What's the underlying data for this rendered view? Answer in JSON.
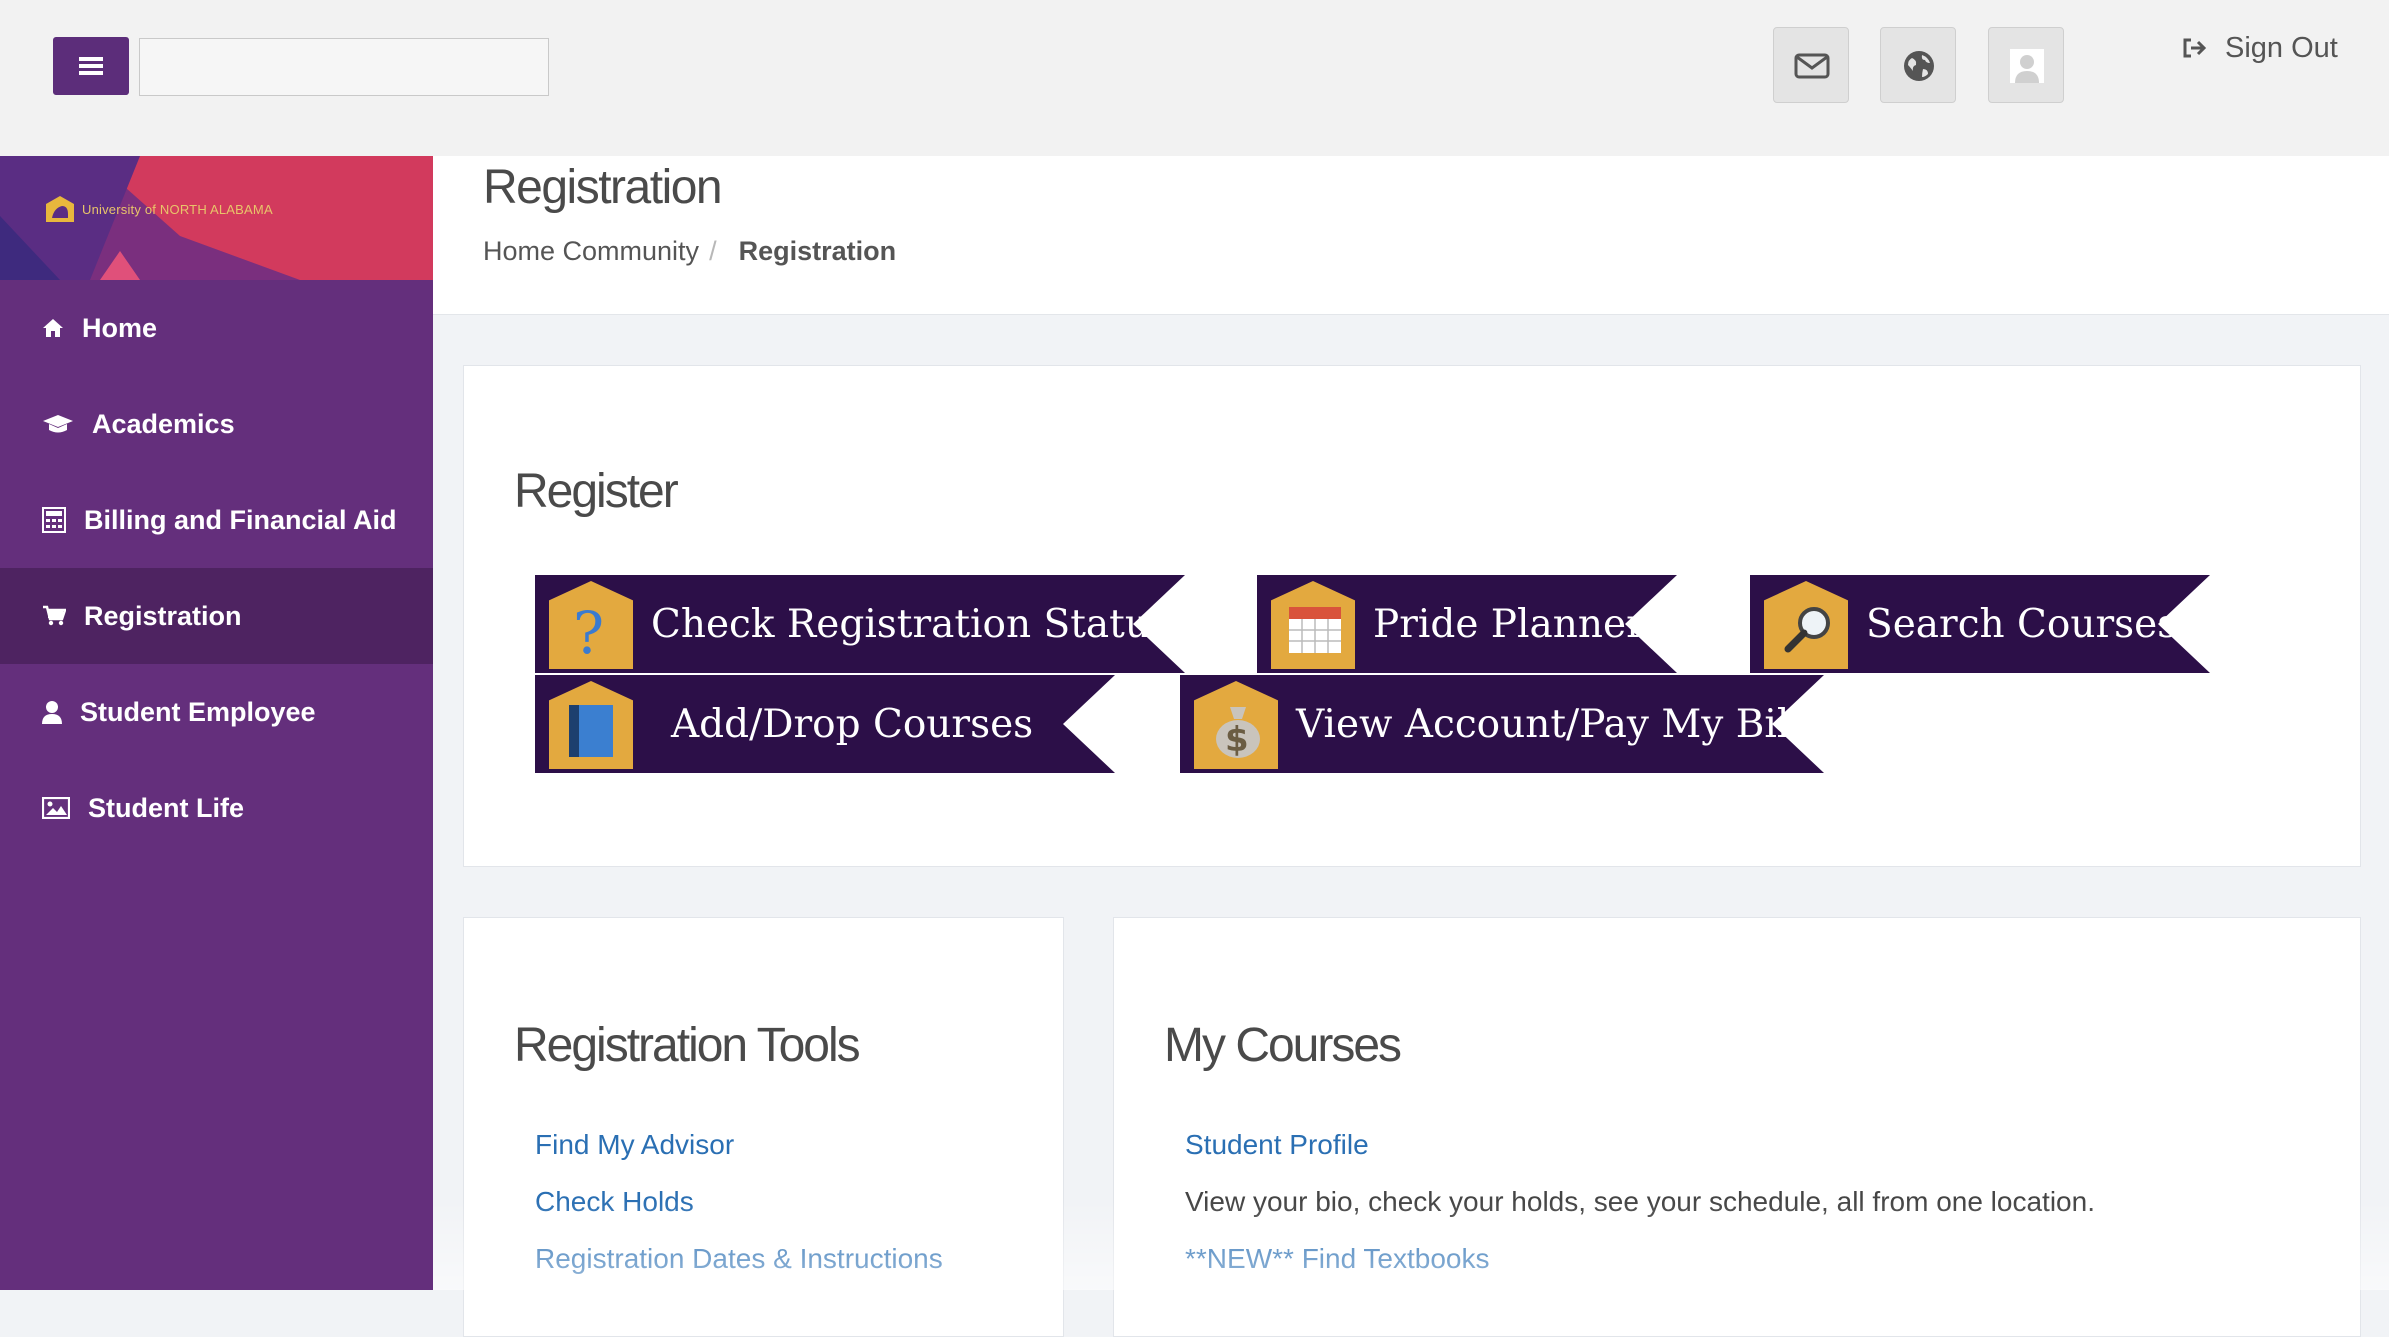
{
  "topbar": {
    "search_value": "",
    "icons": [
      "envelope-icon",
      "globe-icon",
      "user-avatar-icon"
    ],
    "sign_out_label": "Sign Out"
  },
  "sidebar": {
    "logo_text": "University of NORTH ALABAMA",
    "items": [
      {
        "label": "Home",
        "icon": "home-icon"
      },
      {
        "label": "Academics",
        "icon": "graduation-cap-icon"
      },
      {
        "label": "Billing and Financial Aid",
        "icon": "calculator-icon"
      },
      {
        "label": "Registration",
        "icon": "shopping-cart-icon",
        "active": true
      },
      {
        "label": "Student Employee",
        "icon": "user-icon"
      },
      {
        "label": "Student Life",
        "icon": "image-icon"
      }
    ]
  },
  "header": {
    "title": "Registration",
    "breadcrumb": [
      "Home Community",
      "Registration"
    ],
    "separator": "/"
  },
  "register": {
    "title": "Register",
    "tiles": [
      {
        "label": "Check Registration Status",
        "icon": "question-mark-icon"
      },
      {
        "label": "Pride Planner",
        "icon": "calendar-icon"
      },
      {
        "label": "Search Courses",
        "icon": "magnifier-icon"
      },
      {
        "label": "Add/Drop Courses",
        "icon": "book-icon"
      },
      {
        "label": "View Account/Pay My Bill",
        "icon": "money-bag-icon"
      }
    ]
  },
  "registration_tools": {
    "title": "Registration Tools",
    "links": [
      "Find My Advisor",
      "Check Holds",
      "Registration Dates & Instructions"
    ]
  },
  "my_courses": {
    "title": "My Courses",
    "profile_link": "Student Profile",
    "profile_desc": "View your bio, check your holds, see your schedule, all from one location.",
    "textbooks_link": "**NEW** Find Textbooks"
  },
  "colors": {
    "sidebar": "#642f7c",
    "sidebar_active": "#4e2361",
    "tile_bg": "#2c0f48",
    "tile_icon": "#e3a93f",
    "link": "#2a6fb3"
  }
}
